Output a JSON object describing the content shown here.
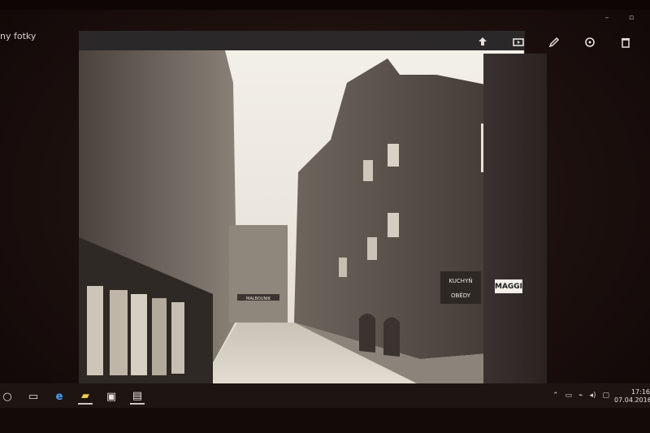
{
  "window": {
    "title": "ny fotky",
    "controls": [
      "minimize-icon",
      "restore-icon"
    ]
  },
  "toolbar": {
    "icons": [
      "share-icon",
      "slideshow-icon",
      "edit-icon",
      "rotate-icon",
      "delete-icon"
    ]
  },
  "photo": {
    "description_visible_text": {
      "shop_sign": "MAGGI",
      "wall_sign_lines": [
        "KUCHYŇ",
        "OBĚDY"
      ],
      "distant_sign": "MALBOUNIK"
    }
  },
  "taskbar": {
    "icons": [
      "search-icon",
      "task-view-icon",
      "edge-icon",
      "file-explorer-icon",
      "store-icon",
      "photos-icon"
    ],
    "tray_icons": [
      "chevron-up-icon",
      "battery-icon",
      "network-icon",
      "volume-icon",
      "notifications-icon"
    ],
    "time": "17:16",
    "date": "07.04.2016"
  },
  "colors": {
    "background": "#1a0f0d",
    "toolbar": "#2e2b2c",
    "photo_tint": "#d8d2c8"
  }
}
